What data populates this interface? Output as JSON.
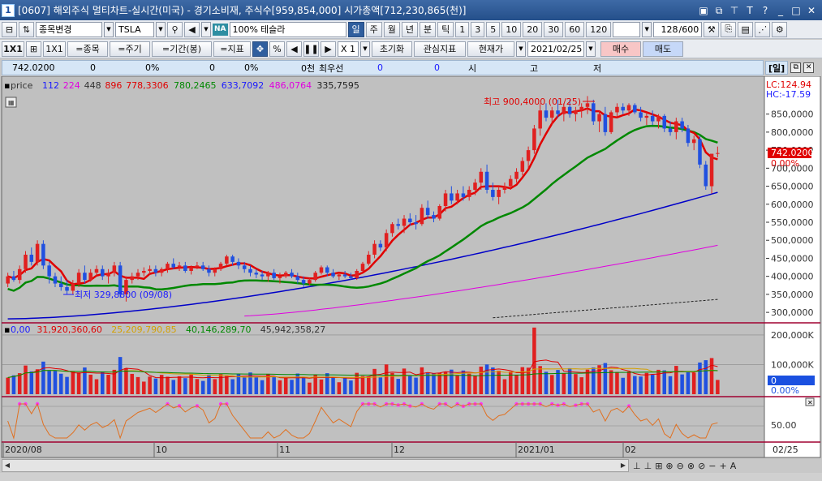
{
  "window": {
    "number": "1",
    "title": "[0607] 해외주식 멀티차트-실시간(미국) - 경기소비재, 주식수[959,854,000] 시가총액[712,230,865(천)]",
    "icons": [
      "tray-icon",
      "restore-icon",
      "pin-icon",
      "text-icon",
      "help-icon",
      "minimize-icon",
      "maximize-icon",
      "close-icon"
    ],
    "icon_glyphs": [
      "▣",
      "⧉",
      "⊤",
      "T",
      "?",
      "_",
      "□",
      "✕"
    ]
  },
  "toolbar1": {
    "category": "종목변경",
    "symbol": "TSLA",
    "na_badge": "NA",
    "zoom": "100%",
    "stock_name": "테슬라",
    "periods": [
      "일",
      "주",
      "월",
      "년",
      "분",
      "틱"
    ],
    "selected_period": "일",
    "intervals": [
      "1",
      "3",
      "5",
      "10",
      "20",
      "30",
      "60",
      "120"
    ],
    "count": "128",
    "count_max": "/600"
  },
  "toolbar2": {
    "view_label": "1X1",
    "view_label2": "1X1",
    "btn_symbol": "=종목",
    "btn_period": "=주기",
    "btn_range": "=기간(봉)",
    "btn_indicator": "=지표",
    "multiplier": "X 1",
    "btn_reset": "초기화",
    "btn_watch": "관심지표",
    "btn_price": "현재가",
    "date": "2021/02/25",
    "btn_buy": "매수",
    "btn_sell": "매도"
  },
  "quote": {
    "price": "742.0200",
    "v1": "0",
    "pct1": "0%",
    "v2": "0",
    "pct2": "0%",
    "v3": "0천",
    "label_best": "최우선",
    "v4": "0",
    "v5": "0",
    "l_open": "시",
    "l_high": "고",
    "l_low": "저",
    "period_badge": "[일]"
  },
  "price_panel": {
    "legend": [
      {
        "text": "price",
        "color": "#333333"
      },
      {
        "text": "112",
        "color": "#1a1aff"
      },
      {
        "text": "224",
        "color": "#e000e0"
      },
      {
        "text": "448",
        "color": "#333333"
      },
      {
        "text": "896",
        "color": "#e00000"
      },
      {
        "text": "778,3306",
        "color": "#e00000"
      },
      {
        "text": "780,2465",
        "color": "#008800"
      },
      {
        "text": "633,7092",
        "color": "#1a1aff"
      },
      {
        "text": "486,0764",
        "color": "#e000e0"
      },
      {
        "text": "335,7595",
        "color": "#222222"
      }
    ],
    "lc": "LC:124.94",
    "hc": "HC:-17.59",
    "high_annotation": "최고 900,4000 (01/25)",
    "low_annotation": "최저 329,8800 (09/08)",
    "current_price_tag": "742.0200",
    "current_pct": "0.00%"
  },
  "volume_panel": {
    "legend": [
      {
        "text": "0,00",
        "color": "#1a1aff"
      },
      {
        "text": "31,920,360,60",
        "color": "#e00000"
      },
      {
        "text": "25,209,790,85",
        "color": "#d4a000"
      },
      {
        "text": "40,146,289,70",
        "color": "#008800"
      },
      {
        "text": "45,942,358,27",
        "color": "#333333"
      }
    ],
    "current_tag": "0",
    "current_pct": "0.00%"
  },
  "osc_panel": {
    "level_label": "50.00"
  },
  "x_labels": [
    "2020/08",
    "10",
    "11",
    "12",
    "2021/01",
    "02",
    "02/25"
  ],
  "bottom_tools": [
    "⊥",
    "⊥",
    "⊞",
    "⊕",
    "⊖",
    "⊗",
    "⊘",
    "−",
    "+",
    "A"
  ],
  "colors": {
    "up": "#e02020",
    "down": "#2050e0",
    "ma5": "#e00000",
    "ma20": "#008800",
    "ma60": "#0000c8",
    "ma120": "#e000e0",
    "ma240": "#222222",
    "osc": "#e07020"
  },
  "chart_data": {
    "type": "candlestick",
    "y_ticks": [
      "850,0000",
      "800,0000",
      "750,0000",
      "700,0000",
      "650,0000",
      "600,0000",
      "550,0000",
      "500,0000",
      "450,0000",
      "400,0000",
      "350,0000",
      "300,0000"
    ],
    "volume_ticks": [
      "200,000K",
      "100,000K"
    ],
    "ylim": [
      280,
      900
    ],
    "candles": [
      [
        380,
        410,
        370,
        400
      ],
      [
        400,
        415,
        385,
        390
      ],
      [
        390,
        430,
        380,
        420
      ],
      [
        420,
        470,
        410,
        460
      ],
      [
        460,
        480,
        430,
        440
      ],
      [
        440,
        500,
        430,
        490
      ],
      [
        490,
        500,
        420,
        430
      ],
      [
        430,
        440,
        380,
        400
      ],
      [
        400,
        410,
        370,
        380
      ],
      [
        380,
        400,
        360,
        370
      ],
      [
        370,
        390,
        350,
        360
      ],
      [
        360,
        390,
        350,
        380
      ],
      [
        380,
        420,
        370,
        410
      ],
      [
        410,
        430,
        380,
        390
      ],
      [
        390,
        420,
        385,
        410
      ],
      [
        410,
        430,
        400,
        420
      ],
      [
        420,
        430,
        390,
        400
      ],
      [
        400,
        420,
        380,
        410
      ],
      [
        410,
        440,
        400,
        430
      ],
      [
        430,
        440,
        340,
        350
      ],
      [
        350,
        400,
        330,
        390
      ],
      [
        390,
        410,
        380,
        400
      ],
      [
        400,
        420,
        390,
        410
      ],
      [
        410,
        425,
        400,
        415
      ],
      [
        415,
        430,
        405,
        420
      ],
      [
        420,
        430,
        400,
        410
      ],
      [
        410,
        425,
        400,
        420
      ],
      [
        420,
        440,
        410,
        435
      ],
      [
        435,
        450,
        420,
        425
      ],
      [
        425,
        440,
        415,
        430
      ],
      [
        430,
        440,
        410,
        415
      ],
      [
        415,
        430,
        405,
        425
      ],
      [
        425,
        440,
        420,
        430
      ],
      [
        430,
        440,
        415,
        420
      ],
      [
        420,
        430,
        400,
        410
      ],
      [
        410,
        425,
        400,
        420
      ],
      [
        420,
        440,
        415,
        435
      ],
      [
        435,
        460,
        430,
        455
      ],
      [
        455,
        460,
        430,
        440
      ],
      [
        440,
        450,
        420,
        430
      ],
      [
        430,
        440,
        410,
        420
      ],
      [
        420,
        430,
        400,
        410
      ],
      [
        410,
        420,
        395,
        405
      ],
      [
        405,
        415,
        390,
        400
      ],
      [
        400,
        415,
        385,
        410
      ],
      [
        410,
        420,
        390,
        395
      ],
      [
        395,
        410,
        380,
        400
      ],
      [
        400,
        415,
        395,
        410
      ],
      [
        410,
        420,
        395,
        400
      ],
      [
        400,
        410,
        380,
        390
      ],
      [
        390,
        400,
        370,
        380
      ],
      [
        380,
        395,
        375,
        390
      ],
      [
        390,
        415,
        385,
        410
      ],
      [
        410,
        430,
        405,
        425
      ],
      [
        425,
        430,
        400,
        410
      ],
      [
        410,
        420,
        395,
        400
      ],
      [
        400,
        410,
        390,
        405
      ],
      [
        405,
        415,
        395,
        400
      ],
      [
        400,
        410,
        390,
        395
      ],
      [
        395,
        420,
        390,
        415
      ],
      [
        415,
        440,
        410,
        435
      ],
      [
        435,
        470,
        430,
        460
      ],
      [
        460,
        500,
        450,
        490
      ],
      [
        490,
        500,
        470,
        480
      ],
      [
        480,
        530,
        470,
        520
      ],
      [
        520,
        550,
        510,
        545
      ],
      [
        545,
        560,
        530,
        540
      ],
      [
        540,
        570,
        520,
        560
      ],
      [
        560,
        575,
        540,
        550
      ],
      [
        550,
        570,
        530,
        545
      ],
      [
        545,
        600,
        540,
        590
      ],
      [
        590,
        610,
        560,
        570
      ],
      [
        570,
        580,
        550,
        560
      ],
      [
        560,
        600,
        555,
        595
      ],
      [
        595,
        640,
        580,
        630
      ],
      [
        630,
        650,
        600,
        610
      ],
      [
        610,
        640,
        600,
        630
      ],
      [
        630,
        650,
        610,
        620
      ],
      [
        620,
        650,
        610,
        640
      ],
      [
        640,
        670,
        625,
        660
      ],
      [
        660,
        700,
        640,
        690
      ],
      [
        690,
        710,
        630,
        640
      ],
      [
        640,
        660,
        610,
        620
      ],
      [
        620,
        650,
        600,
        640
      ],
      [
        640,
        660,
        630,
        650
      ],
      [
        650,
        680,
        640,
        670
      ],
      [
        670,
        700,
        660,
        690
      ],
      [
        690,
        730,
        680,
        720
      ],
      [
        720,
        760,
        700,
        750
      ],
      [
        750,
        820,
        740,
        810
      ],
      [
        810,
        880,
        790,
        860
      ],
      [
        860,
        880,
        830,
        840
      ],
      [
        840,
        870,
        820,
        860
      ],
      [
        860,
        890,
        840,
        850
      ],
      [
        850,
        880,
        830,
        870
      ],
      [
        870,
        890,
        840,
        850
      ],
      [
        850,
        870,
        830,
        860
      ],
      [
        860,
        880,
        840,
        870
      ],
      [
        870,
        900,
        850,
        880
      ],
      [
        880,
        890,
        820,
        830
      ],
      [
        830,
        860,
        800,
        850
      ],
      [
        850,
        870,
        790,
        800
      ],
      [
        800,
        860,
        795,
        855
      ],
      [
        855,
        880,
        840,
        870
      ],
      [
        870,
        880,
        850,
        860
      ],
      [
        860,
        880,
        845,
        875
      ],
      [
        875,
        880,
        850,
        855
      ],
      [
        855,
        870,
        830,
        840
      ],
      [
        840,
        855,
        820,
        845
      ],
      [
        845,
        860,
        820,
        830
      ],
      [
        830,
        850,
        810,
        845
      ],
      [
        845,
        850,
        800,
        810
      ],
      [
        810,
        830,
        790,
        800
      ],
      [
        800,
        840,
        780,
        830
      ],
      [
        830,
        840,
        800,
        810
      ],
      [
        810,
        820,
        760,
        770
      ],
      [
        770,
        790,
        750,
        780
      ],
      [
        780,
        790,
        700,
        710
      ],
      [
        710,
        720,
        640,
        650
      ],
      [
        650,
        730,
        630,
        740
      ],
      [
        740,
        760,
        730,
        742
      ]
    ],
    "ma5_line": [],
    "volume": []
  }
}
